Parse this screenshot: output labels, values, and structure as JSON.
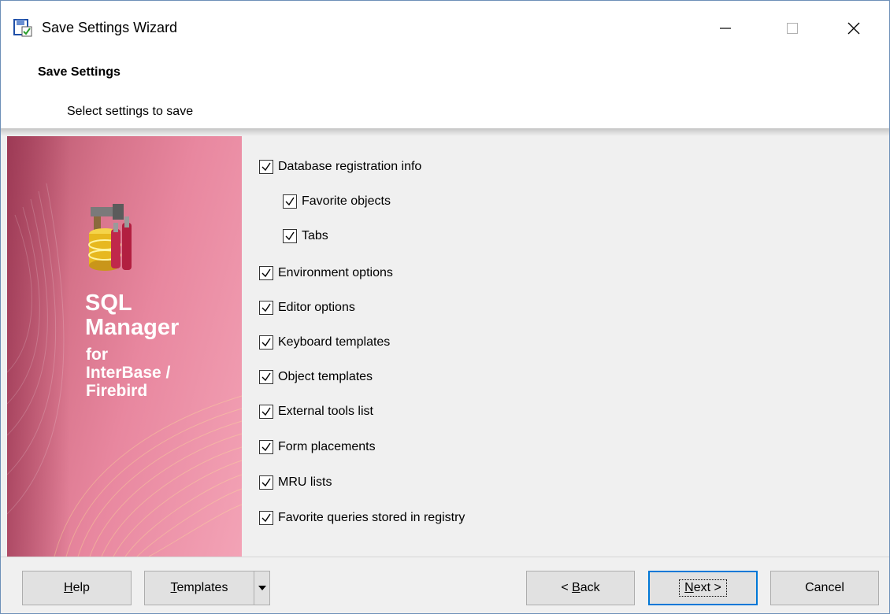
{
  "window": {
    "title": "Save Settings Wizard",
    "controls": [
      "minimize",
      "maximize",
      "close"
    ]
  },
  "header": {
    "title": "Save Settings",
    "subtitle": "Select settings to save"
  },
  "banner": {
    "line1": "SQL",
    "line2": "Manager",
    "for": "for",
    "product1": "InterBase /",
    "product2": "Firebird",
    "colors": {
      "pink_light": "#f3a3b6",
      "pink_dark": "#b25068"
    }
  },
  "options": [
    {
      "label": "Database registration info",
      "checked": true,
      "indent": 0
    },
    {
      "label": "Favorite objects",
      "checked": true,
      "indent": 1
    },
    {
      "label": "Tabs",
      "checked": true,
      "indent": 1
    },
    {
      "label": "Environment options",
      "checked": true,
      "indent": 0
    },
    {
      "label": "Editor options",
      "checked": true,
      "indent": 0
    },
    {
      "label": "Keyboard templates",
      "checked": true,
      "indent": 0
    },
    {
      "label": "Object templates",
      "checked": true,
      "indent": 0
    },
    {
      "label": "External tools list",
      "checked": true,
      "indent": 0
    },
    {
      "label": "Form placements",
      "checked": true,
      "indent": 0
    },
    {
      "label": "MRU lists",
      "checked": true,
      "indent": 0
    },
    {
      "label": "Favorite queries stored in registry",
      "checked": true,
      "indent": 0
    }
  ],
  "buttons": {
    "help": {
      "mnemonic": "H",
      "rest": "elp"
    },
    "templates": {
      "mnemonic": "T",
      "rest": "emplates"
    },
    "back": {
      "prefix": "< ",
      "mnemonic": "B",
      "rest": "ack"
    },
    "next": {
      "mnemonic": "N",
      "rest": "ext >"
    },
    "cancel": {
      "label": "Cancel"
    }
  },
  "colors": {
    "accent": "#0078d7",
    "dialog_bg": "#f0f0f0"
  }
}
